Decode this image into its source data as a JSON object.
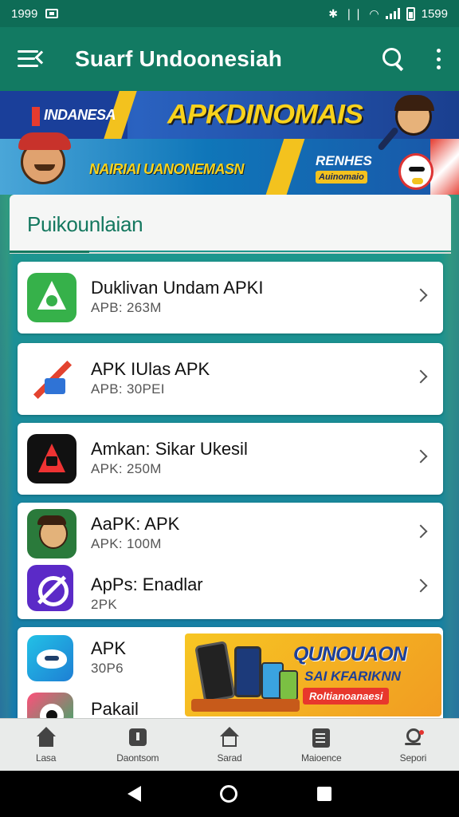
{
  "status_bar": {
    "time_left": "1999",
    "time_right": "1599",
    "icons": [
      "notification-icon",
      "bluetooth-icon",
      "vibrate-icon",
      "wifi-icon",
      "signal-icon",
      "battery-icon"
    ]
  },
  "app_bar": {
    "title": "Suarf Undoonesiah",
    "icons": [
      "menu-icon",
      "search-icon",
      "more-vert-icon"
    ]
  },
  "banner": {
    "brand": "INDANESA",
    "headline": "APKDINOMAIS",
    "subheadline": "NAIRIAI UANONEMASN",
    "badge_title": "RENHES",
    "badge_sub": "Auinomaio"
  },
  "section": {
    "title": "Puikounlaian"
  },
  "apps": [
    {
      "name": "Duklivan Undam APKI",
      "size": "APB: 263M",
      "icon": "green-triangle-icon"
    },
    {
      "name": "APK IUlas APK",
      "size": "APB: 30PEI",
      "icon": "red-x-icon"
    },
    {
      "name": "Amkan: Sikar Ukesil",
      "size": "APK: 250M",
      "icon": "red-a-icon"
    },
    {
      "name": "AaPK: APK",
      "size": "APK: 100M",
      "icon": "face-icon"
    },
    {
      "name": "ApPs: Enadlar",
      "size": "2PK",
      "icon": "purple-circle-icon"
    },
    {
      "name": "APK",
      "size": "30P6",
      "icon": "blue-mask-icon"
    },
    {
      "name": "Pakail",
      "size": "",
      "icon": "pink-eye-icon"
    }
  ],
  "promo": {
    "headline": "QUNOUAON",
    "subline": "SAI KFARIKNN",
    "cta": "Roltianoanaesi"
  },
  "bottom_nav": [
    {
      "label": "Lasa",
      "icon": "home-icon"
    },
    {
      "label": "Daontsom",
      "icon": "download-icon"
    },
    {
      "label": "Sarad",
      "icon": "house-outline-icon"
    },
    {
      "label": "Maioence",
      "icon": "list-icon"
    },
    {
      "label": "Sepori",
      "icon": "profile-icon"
    }
  ],
  "system_nav": {
    "icons": [
      "back-icon",
      "home-circle-icon",
      "recents-icon"
    ]
  },
  "colors": {
    "primary": "#127a62",
    "status_bar": "#0e6c56",
    "accent_yellow": "#f8d21c",
    "section_title": "#14785f"
  }
}
